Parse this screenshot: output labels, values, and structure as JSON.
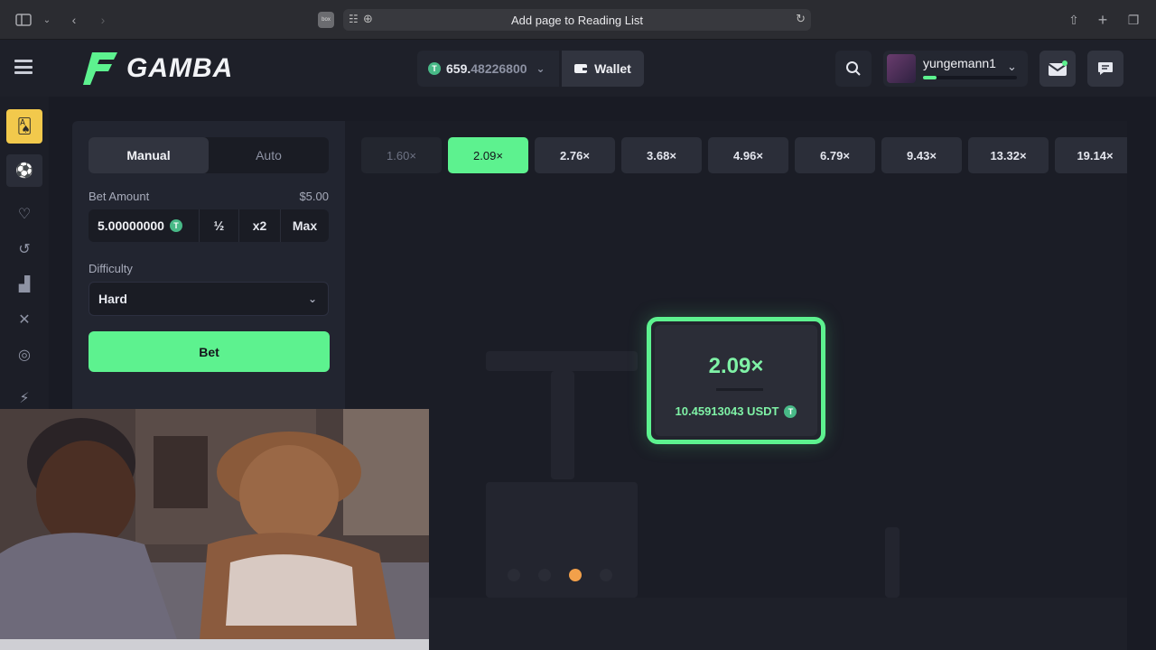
{
  "browser": {
    "site_icon_text": "box",
    "url_text": "Add page to Reading List"
  },
  "header": {
    "logo_text": "GAMBA",
    "balance_main": "659.",
    "balance_decimals": "48226800",
    "currency_symbol": "T",
    "wallet_label": "Wallet",
    "username": "yungemann1",
    "xp_progress": 0.14,
    "brand_color": "#5df28f"
  },
  "sidebar": {
    "items": [
      "cards-icon",
      "sports-icon",
      "heart-icon",
      "history-icon",
      "chart-icon",
      "swords-icon",
      "target-icon",
      "gamba-icon"
    ]
  },
  "controls": {
    "tabs": [
      {
        "label": "Manual"
      },
      {
        "label": "Auto"
      }
    ],
    "bet_amount_label": "Bet Amount",
    "bet_amount_usd": "$5.00",
    "bet_amount_value": "5.00000000",
    "half_label": "½",
    "double_label": "x2",
    "max_label": "Max",
    "difficulty_label": "Difficulty",
    "difficulty_value": "Hard",
    "bet_button": "Bet"
  },
  "game": {
    "multipliers": [
      "1.60×",
      "2.09×",
      "2.76×",
      "3.68×",
      "4.96×",
      "6.79×",
      "9.43×",
      "13.32×",
      "19.14×"
    ],
    "selected_index": 1,
    "result_multiplier": "2.09×",
    "result_amount": "10.45913043 USDT",
    "active_step": 2,
    "step_count": 4
  }
}
